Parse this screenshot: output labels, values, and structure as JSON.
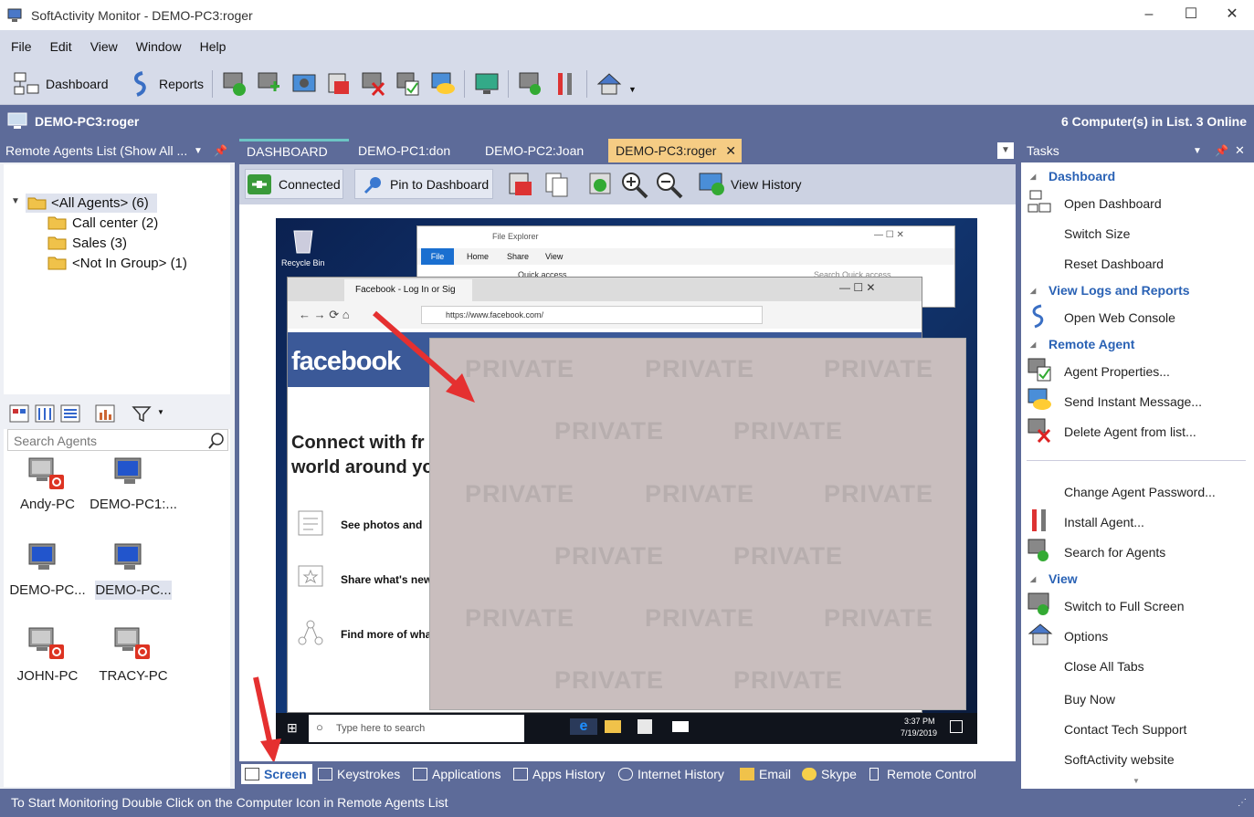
{
  "window": {
    "title": "SoftActivity Monitor - DEMO-PC3:roger"
  },
  "menu": [
    "File",
    "Edit",
    "View",
    "Window",
    "Help"
  ],
  "toolbar": {
    "dashboard": "Dashboard",
    "reports": "Reports"
  },
  "header": {
    "current": "DEMO-PC3:roger",
    "summary": "6 Computer(s) in List. 3 Online"
  },
  "left": {
    "title": "Remote Agents List (Show All ...",
    "tree": {
      "root": "<All Agents> (6)",
      "groups": [
        "Call center (2)",
        "Sales (3)",
        "<Not In Group> (1)"
      ]
    },
    "search_placeholder": "Search Agents",
    "agents": [
      "Andy-PC",
      "DEMO-PC1:...",
      "DEMO-PC...",
      "DEMO-PC...",
      "JOHN-PC",
      "TRACY-PC"
    ]
  },
  "tabs": [
    "DASHBOARD",
    "DEMO-PC1:don",
    "DEMO-PC2:Joan",
    "DEMO-PC3:roger"
  ],
  "subtoolbar": {
    "connected": "Connected",
    "pin": "Pin to Dashboard",
    "history": "View History"
  },
  "screen": {
    "recycle": "Recycle Bin",
    "explorer_title": "File Explorer",
    "explorer_tabs": [
      "File",
      "Home",
      "Share",
      "View"
    ],
    "explorer_addr": "Quick access",
    "explorer_search": "Search Quick access",
    "browser_tab": "Facebook - Log In or Sig",
    "url": "https://www.facebook.com/",
    "fb_logo": "facebook",
    "fb_head1": "Connect with fr",
    "fb_head2": "world around yo",
    "fb_items": [
      "See photos and",
      "Share what's new",
      "Find more of wha"
    ],
    "private": "PRIVATE",
    "taskbar_search": "Type here to search",
    "time": "3:37 PM",
    "date": "7/19/2019"
  },
  "bottomtabs": [
    "Screen",
    "Keystrokes",
    "Applications",
    "Apps History",
    "Internet History",
    "Email",
    "Skype",
    "Remote Control"
  ],
  "tasks": {
    "title": "Tasks",
    "sections": {
      "dashboard": "Dashboard",
      "logs": "View Logs and Reports",
      "remote": "Remote Agent",
      "view": "View"
    },
    "items": {
      "open_dashboard": "Open Dashboard",
      "switch_size": "Switch Size",
      "reset_dashboard": "Reset Dashboard",
      "web_console": "Open Web Console",
      "agent_props": "Agent Properties...",
      "send_msg": "Send Instant Message...",
      "delete_agent": "Delete Agent from list...",
      "change_pw": "Change Agent Password...",
      "install": "Install Agent...",
      "search": "Search for Agents",
      "full_screen": "Switch to Full Screen",
      "options": "Options",
      "close_tabs": "Close All Tabs",
      "buy": "Buy Now",
      "support": "Contact Tech Support",
      "website": "SoftActivity website"
    }
  },
  "status": "To Start Monitoring Double Click on the Computer Icon in Remote Agents List"
}
